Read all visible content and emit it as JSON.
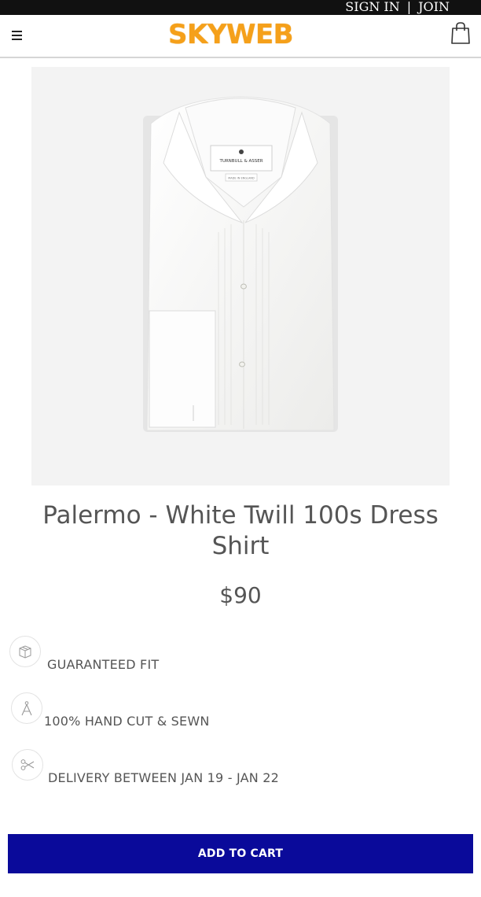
{
  "topbar": {
    "sign_in": "SIGN IN",
    "separator": "|",
    "join": "JOIN"
  },
  "header": {
    "logo": "SKYWEB",
    "menu_icon": "hamburger-menu-icon",
    "cart_icon": "shopping-bag-icon"
  },
  "product": {
    "title": "Palermo - White Twill 100s Dress Shirt",
    "price": "$90",
    "image_logo_text": "TURNBULL & ASSER",
    "image_label_text": "MADE IN ENGLAND"
  },
  "features": [
    {
      "icon": "box-icon",
      "label": "GUARANTEED FIT"
    },
    {
      "icon": "compass-icon",
      "label": "100% HAND CUT & SEWN"
    },
    {
      "icon": "scissors-icon",
      "label": "DELIVERY BETWEEN JAN 19 - JAN 22"
    }
  ],
  "cta": {
    "add_to_cart": "ADD TO CART"
  },
  "colors": {
    "accent": "#0a0a9a",
    "logo": "#f5a01a",
    "topbar": "#111111"
  }
}
